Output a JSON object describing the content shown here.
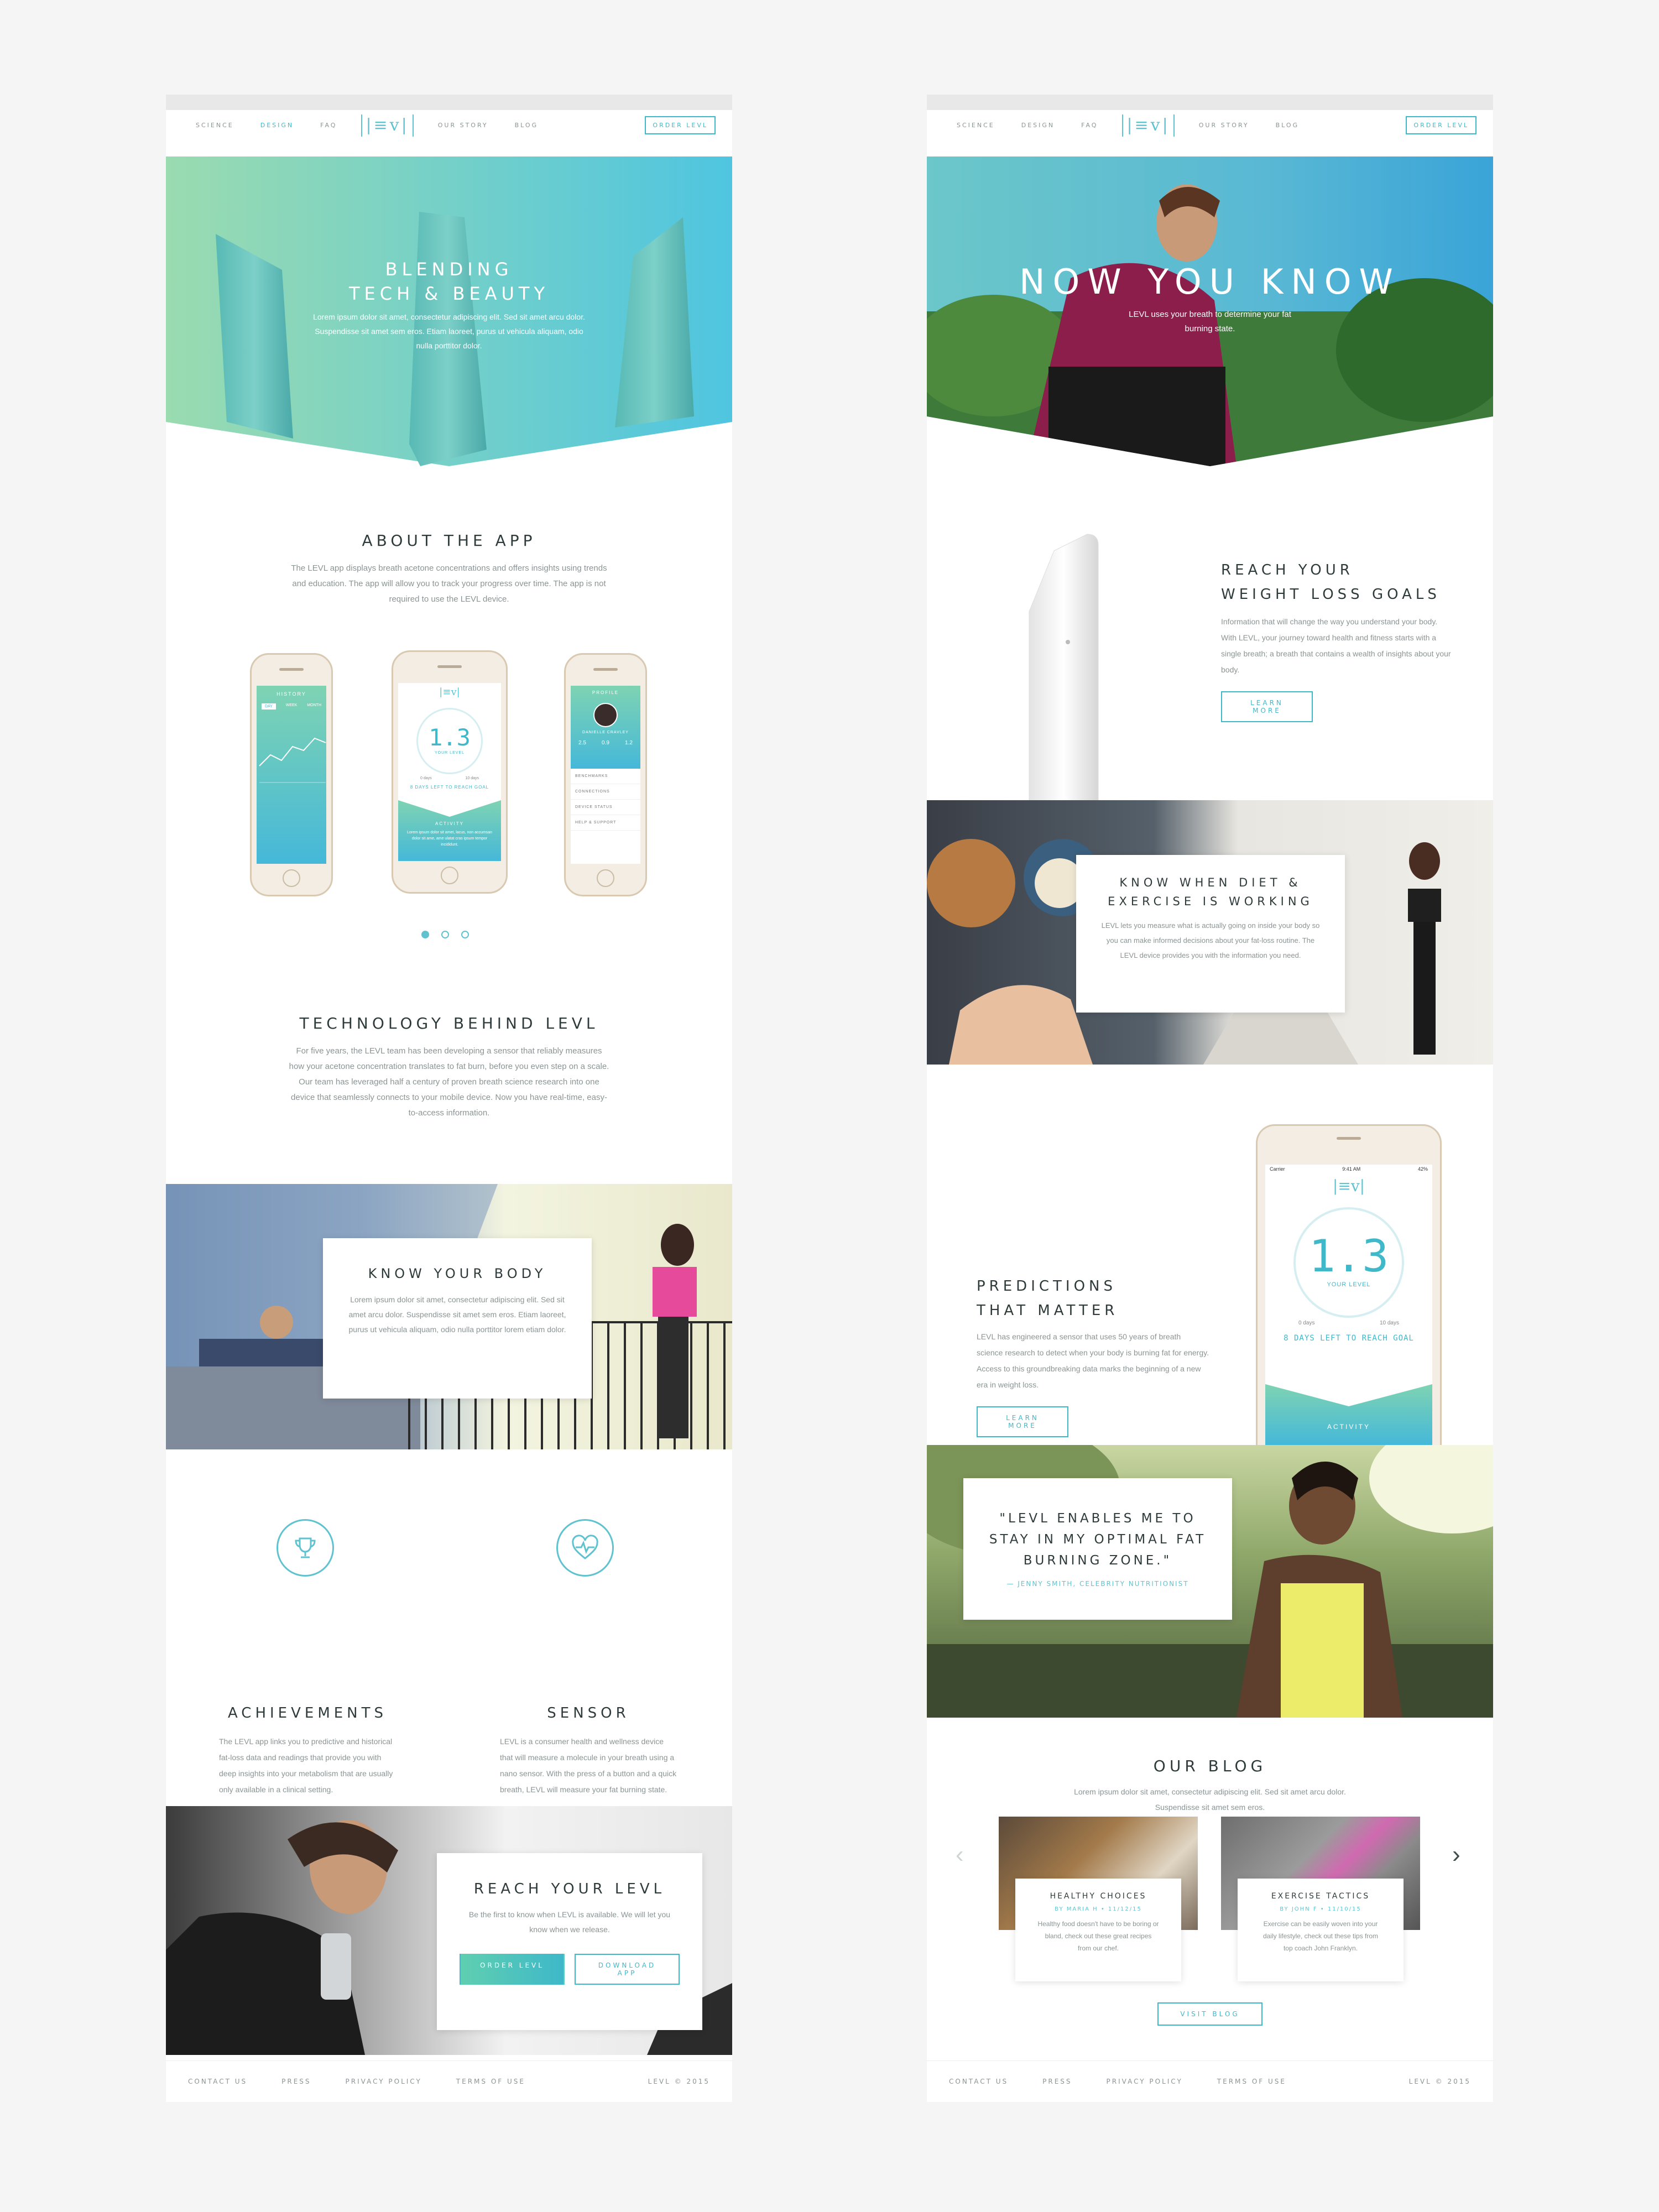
{
  "colors": {
    "accent": "#3fb8c9",
    "accent_light": "#5fc3cf",
    "text_dark": "#2f3b3b",
    "text_body": "#8b9494",
    "background": "#f5f5f5"
  },
  "page_a": {
    "nav": {
      "items": [
        "SCIENCE",
        "DESIGN",
        "FAQ"
      ],
      "items_right": [
        "OUR STORY",
        "BLOG"
      ],
      "logo": "|≡v|",
      "order": "ORDER LEVL"
    },
    "hero": {
      "title_line1": "BLENDING",
      "title_line2": "TECH & BEAUTY",
      "text": "Lorem ipsum dolor sit amet, consectetur adipiscing elit. Sed sit amet arcu dolor. Suspendisse sit amet sem eros. Etiam laoreet, purus ut vehicula aliquam, odio nulla porttitor dolor."
    },
    "about": {
      "title": "ABOUT THE APP",
      "text": "The LEVL app displays breath acetone concentrations and offers insights using trends and education. The app will allow you to track your progress over time. The app is not required to use the LEVL device."
    },
    "phones": {
      "left": {
        "header": "HISTORY",
        "tabs": [
          "DAY",
          "WEEK",
          "MONTH"
        ]
      },
      "center": {
        "logo": "|≡v|",
        "value": "1.3",
        "unit": "YOUR LEVEL",
        "days_left": "8 DAYS LEFT TO REACH GOAL",
        "activity": "ACTIVITY",
        "min": "0 days",
        "max": "10 days",
        "desc": "Lorem ipsum dolor sit amet, lacus, non accumsan dolor sit ame, ame ulatat cras ipsum tempor incididunt."
      },
      "right": {
        "header": "PROFILE",
        "name": "DANIELLE CRAVLEY",
        "stats": [
          "2.5",
          "0.9",
          "1.2"
        ],
        "list": [
          "BENCHMARKS",
          "CONNECTIONS",
          "DEVICE STATUS",
          "HELP & SUPPORT"
        ]
      }
    },
    "carousel": {
      "dots": 3,
      "active": 1
    },
    "technology": {
      "title": "TECHNOLOGY BEHIND LEVL",
      "text": "For five years, the LEVL team has been developing a sensor that reliably measures how your acetone concentration translates to fat burn, before you even step on a scale. Our team has leveraged half a century of proven breath science research into one device that seamlessly connects to your mobile device. Now you have real-time, easy-to-access information."
    },
    "know_body": {
      "title": "KNOW YOUR BODY",
      "text": "Lorem ipsum dolor sit amet, consectetur adipiscing elit. Sed sit amet arcu dolor. Suspendisse sit amet sem eros. Etiam laoreet, purus ut vehicula aliquam, odio nulla porttitor lorem etiam dolor."
    },
    "features": [
      {
        "icon": "trophy-icon",
        "title": "ACHIEVEMENTS",
        "text": "The LEVL app links you to predictive and historical fat-loss data and readings that provide you with deep insights into your metabolism that are usually only available in a clinical setting."
      },
      {
        "icon": "heart-pulse-icon",
        "title": "SENSOR",
        "text": "LEVL is a consumer health and wellness device that will measure a molecule in your breath using a nano sensor. With the press of a button and a quick breath, LEVL will measure your fat burning state."
      }
    ],
    "reach": {
      "title": "REACH YOUR LEVL",
      "text": "Be the first to know when LEVL is available. We will let you know when we release.",
      "btn_order": "ORDER LEVL",
      "btn_download": "DOWNLOAD APP"
    },
    "footer": {
      "items": [
        "CONTACT US",
        "PRESS",
        "PRIVACY POLICY",
        "TERMS OF USE"
      ],
      "copy": "LEVL © 2015"
    }
  },
  "page_b": {
    "nav": {
      "items": [
        "SCIENCE",
        "DESIGN",
        "FAQ"
      ],
      "items_right": [
        "OUR STORY",
        "BLOG"
      ],
      "logo": "|≡v|",
      "order": "ORDER LEVL"
    },
    "hero": {
      "title": "NOW YOU KNOW",
      "text": "LEVL uses your breath to determine your fat burning state."
    },
    "reach_goals": {
      "title_line1": "REACH YOUR",
      "title_line2": "WEIGHT LOSS GOALS",
      "text": "Information that will change the way you understand your body. With LEVL, your journey toward health and fitness starts with a single breath; a breath that contains a wealth of insights about your body.",
      "button": "LEARN MORE"
    },
    "diet": {
      "title_line1": "KNOW WHEN DIET &",
      "title_line2": "EXERCISE IS WORKING",
      "text": "LEVL lets you measure what is actually going on inside your body so you can make informed decisions about your fat-loss routine. The LEVL device provides you with the information you need."
    },
    "predictions": {
      "title_line1": "PREDICTIONS",
      "title_line2": "THAT MATTER",
      "text": "LEVL has engineered a sensor that uses 50 years of breath science research to detect when your body is burning fat for energy. Access to this groundbreaking data marks the beginning of a new era in weight loss.",
      "button": "LEARN MORE"
    },
    "phone": {
      "carrier": "Carrier",
      "time": "9:41 AM",
      "battery": "42%",
      "logo": "|≡v|",
      "value": "1.3",
      "unit": "YOUR LEVEL",
      "min": "0 days",
      "max": "10 days",
      "days_left": "8 DAYS LEFT TO REACH GOAL",
      "activity": "ACTIVITY"
    },
    "quote": {
      "line1": "\"LEVL ENABLES ME TO",
      "line2": "STAY IN MY OPTIMAL FAT",
      "line3": "BURNING ZONE.\"",
      "author": "— JENNY SMITH, CELEBRITY NUTRITIONIST"
    },
    "blog": {
      "title": "OUR BLOG",
      "text": "Lorem ipsum dolor sit amet, consectetur adipiscing elit. Sed sit amet arcu dolor. Suspendisse sit amet sem eros.",
      "posts": [
        {
          "title": "HEALTHY CHOICES",
          "meta": "BY MARIA H • 11/12/15",
          "text": "Healthy food doesn't have to be boring or bland, check out these great recipes from our chef."
        },
        {
          "title": "EXERCISE TACTICS",
          "meta": "BY JOHN F • 11/10/15",
          "text": "Exercise can be easily woven into your daily lifestyle, check out these tips from top coach John Franklyn."
        }
      ],
      "button": "VISIT BLOG"
    },
    "footer": {
      "items": [
        "CONTACT US",
        "PRESS",
        "PRIVACY POLICY",
        "TERMS OF USE"
      ],
      "copy": "LEVL © 2015"
    }
  }
}
